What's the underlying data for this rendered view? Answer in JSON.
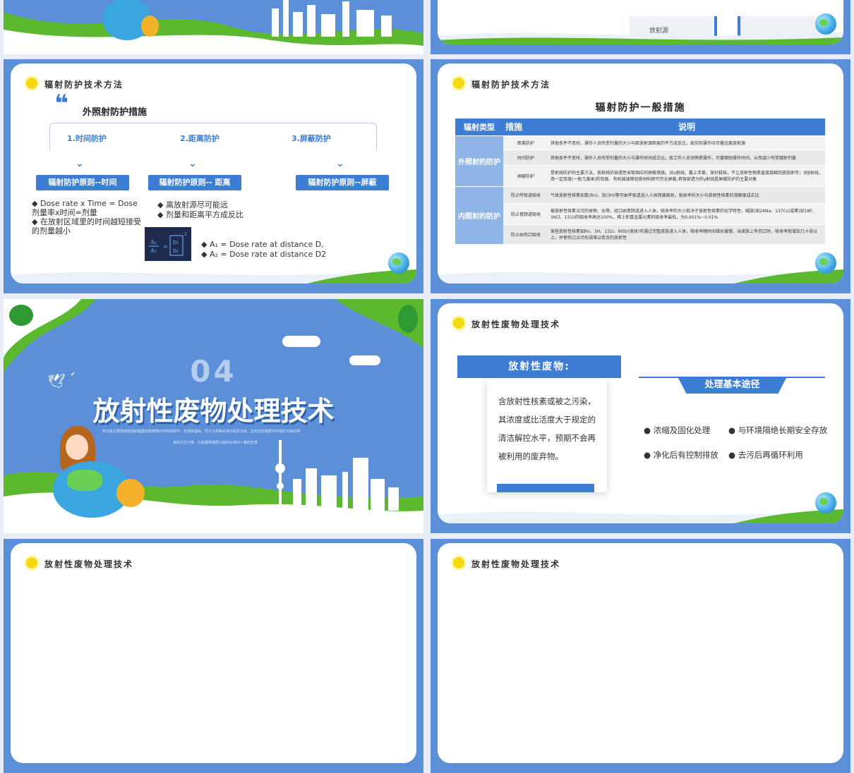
{
  "slides": {
    "s3": {
      "title": "辐射防护技术方法",
      "quote_mark": "❝",
      "heading": "外照射防护措施",
      "tabs": [
        "1.时间防护",
        "2.距离防护",
        "3.屏蔽防护"
      ],
      "principles": [
        "辐射防护原则--时间",
        "辐射防护原则-- 距离",
        "辐射防护原则--屏蔽"
      ],
      "time_bullets": [
        "Dose rate x Time = Dose 剂量率x时间=剂量",
        "在放射区域里的时间越短接受的剂量越小"
      ],
      "distance_bullets": [
        "离放射源尽可能远",
        "剂量和距离平方成反比"
      ],
      "formula_bullets": [
        "A₁ = Dose rate at distance D,",
        "A₂ = Dose rate at distance D2"
      ]
    },
    "s4": {
      "title": "辐射防护技术方法",
      "table_title": "辐射防护一般措施",
      "headers": [
        "辐射类型",
        "措施",
        "说明"
      ],
      "groups": [
        "外照射的防护",
        "内照射的防护"
      ],
      "rows": [
        {
          "measure": "距离防护",
          "desc": "其他条件不变时，操作人员所受剂量的大小与距放射源距离的平方成反比，故实际操作应尽量远离放射源"
        },
        {
          "measure": "时间防护",
          "desc": "其他条件不变时，操作人员所受剂量的大小与操作时间成正比，故工作人员须熟悉操作，尽量缩短操作时间，从而减少所受辐射剂量"
        },
        {
          "measure": "屏蔽防护",
          "desc": "是射线防护的主要方法，依射线的穿透性采取相应的屏蔽措施。对α射线，戴上手套，穿好鞋袜，不让放射性物质直接接触到皮肤即可；对β射线，用一定厚度(一般几毫米)的铝板、有机玻璃等轻质材料即可完全屏蔽;具强穿透力的γ射线是屏蔽防护的主要对象"
        },
        {
          "measure": "防止呼吸道吸收",
          "desc": "气体放射性核素如氡(Rn)、氚(3H)等可由呼吸道进入人体而被吸收，吸收率的大小与放射性核素的溶解度成正比"
        },
        {
          "measure": "防止胃肠道吸收",
          "desc": "被放射性核素沾污的食物、水等，经口由胃肠道进入人体，吸收率的大小取决于放射性核素的化学特性，碱族(如24Na、137Cs)或素(如18F、36Cl、131I)的吸收率高达100%，稀土和重金属元素的吸收率最低，为0.001%~0.01%"
        },
        {
          "measure": "防止由伤口吸收",
          "desc": "某些放射性核素如Rn、3H、131I、90Sr(液体)可通过完整皮肤进入人体，吸收率随时间增长缓慢，当皮肤上有伤口时，吸收率就增加几十倍以上，并使伤口沾污形成难以愈合的放射性"
        }
      ]
    },
    "s5": {
      "number": "04",
      "title": "放射性废物处理技术",
      "desc_line1": "核污染主要指核能放射装置的建筑物对环境的破坏，包括核辐射，原子尘埃等本身引起的污染，还有这些物质对环境的污染后带",
      "desc_line2": "来的次生污染，比如被核物质污染的水源对人畜的伤害"
    },
    "s6": {
      "title": "放射性废物处理技术",
      "box_title": "放射性废物:",
      "box_text": "含放射性核素或被之污染，其浓度或比活度大于规定的清洁解控水平，预期不会再被利用的废弃物。",
      "ribbon": "处理基本途径",
      "methods": [
        "浓缩及固化处理",
        "与环境隔绝长期安全存放",
        "净化后有控制排放",
        "去污后再循环利用"
      ]
    },
    "s7": {
      "title": "放射性废物处理技术"
    },
    "s8": {
      "title": "放射性废物处理技术"
    },
    "s2": {
      "box_label": "放射源"
    }
  },
  "colors": {
    "blue": "#3d7dd3",
    "green": "#5cb82e",
    "yellow": "#f5d90f",
    "bg": "#5b8fd8"
  }
}
